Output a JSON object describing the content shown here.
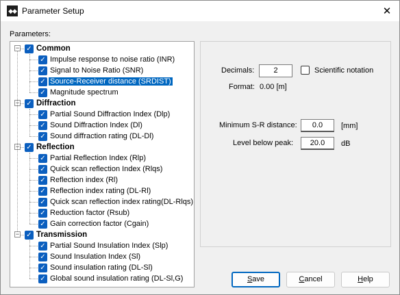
{
  "window": {
    "title": "Parameter Setup",
    "close_glyph": "✕"
  },
  "parameters_label": "Parameters:",
  "tree": [
    {
      "group": "Common",
      "items": [
        "Impulse response to noise ratio (INR)",
        "Signal to Noise Ratio (SNR)",
        "Source-Receiver distance (SRDIST)",
        "Magnitude spectrum"
      ],
      "selected": 2
    },
    {
      "group": "Diffraction",
      "items": [
        "Partial Sound Diffraction Index (Dlp)",
        "Sound Diffraction Index (Dl)",
        "Sound diffraction rating (DL-Dl)"
      ]
    },
    {
      "group": "Reflection",
      "items": [
        "Partial Reflection Index (Rlp)",
        "Quick scan reflection Index (Rlqs)",
        "Reflection index (Rl)",
        "Reflection index rating (DL-Rl)",
        "Quick scan reflection index rating(DL-Rlqs)",
        "Reduction factor (Rsub)",
        "Gain correction factor (Cgain)"
      ]
    },
    {
      "group": "Transmission",
      "items": [
        "Partial Sound Insulation Index (Slp)",
        "Sound Insulation Index (Sl)",
        "Sound insulation rating (DL-Sl)",
        "Global sound insulation rating (DL-Sl,G)"
      ]
    }
  ],
  "settings": {
    "decimals_label": "Decimals:",
    "decimals_value": "2",
    "scientific_label": "Scientific notation",
    "scientific_checked": false,
    "format_label": "Format:",
    "format_value": "0.00 [m]",
    "min_sr_label": "Minimum S-R distance:",
    "min_sr_value": "0.0",
    "min_sr_unit": "[mm]",
    "level_label": "Level below peak:",
    "level_value": "20.0",
    "level_unit": "dB"
  },
  "buttons": {
    "save": {
      "mnemonic": "S",
      "rest": "ave"
    },
    "cancel": {
      "mnemonic": "C",
      "rest": "ancel"
    },
    "help": {
      "mnemonic": "H",
      "rest": "elp"
    }
  },
  "colors": {
    "accent": "#0067c0",
    "checkbox": "#0b5fbf",
    "window_bg": "#f0f0f0"
  }
}
